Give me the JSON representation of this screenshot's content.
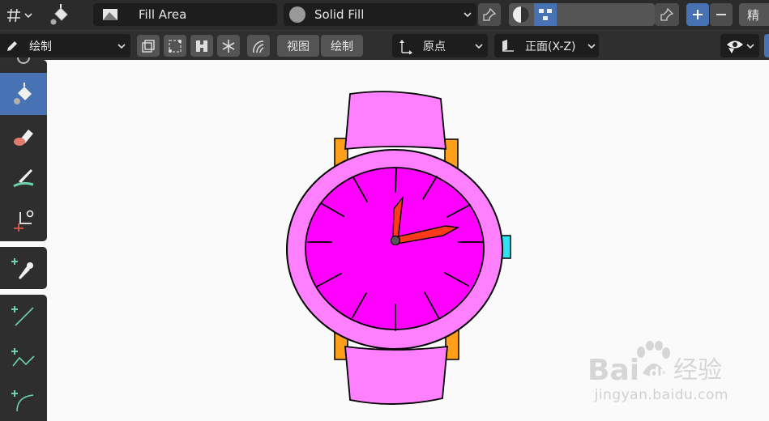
{
  "topbar": {
    "layer_name": "Fill Area",
    "material_mode": "Solid Fill",
    "overflow_label": "精"
  },
  "toolbar2": {
    "mode_label": "绘制",
    "view_label": "视图",
    "draw_label": "绘制",
    "origin_label": "原点",
    "orientation_label": "正面(X-Z)"
  },
  "watermark": {
    "brand": "Bai",
    "brand2": "du",
    "site_cn": "经验",
    "url": "jingyan.baidu.com"
  },
  "colors": {
    "strap": "#ff80ff",
    "case": "#ff80ff",
    "dial": "#ff00ff",
    "lug": "#ff9f1a",
    "crown": "#2de3f0",
    "hand": "#ff3a1a",
    "accent": "#4772b3"
  }
}
